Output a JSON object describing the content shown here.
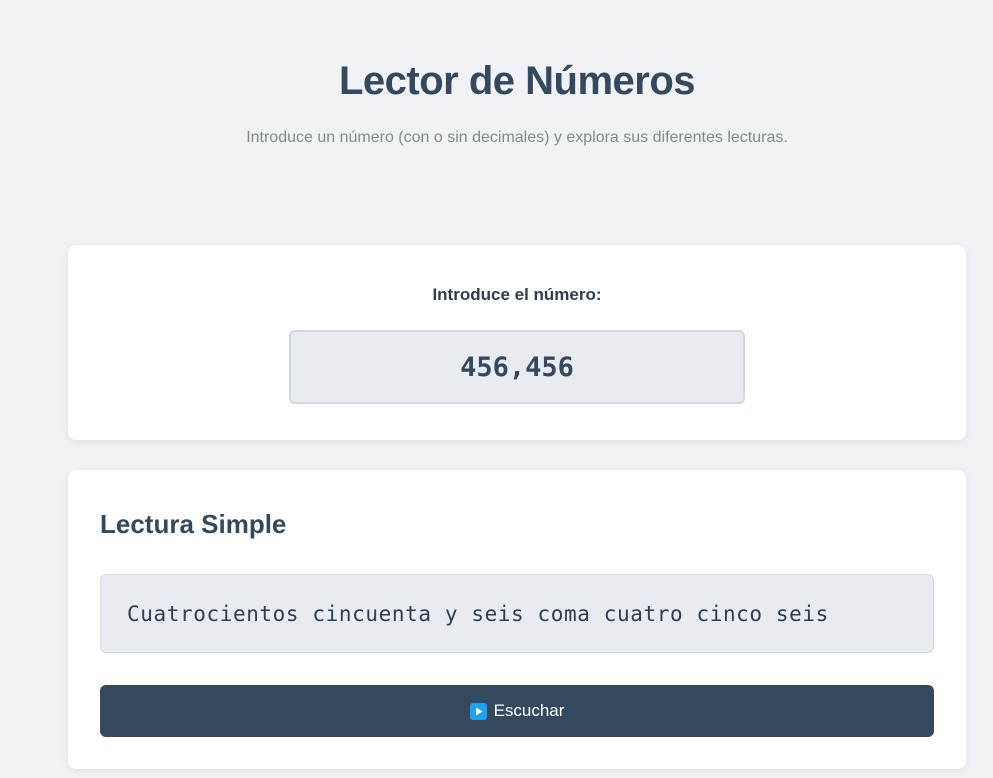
{
  "header": {
    "title": "Lector de Números",
    "subtitle": "Introduce un número (con o sin decimales) y explora sus diferentes lecturas."
  },
  "input_section": {
    "label": "Introduce el número:",
    "value": "456,456"
  },
  "reading_section": {
    "title": "Lectura Simple",
    "text": "Cuatrocientos cincuenta y seis coma cuatro cinco seis",
    "button_label": "Escuchar",
    "button_icon": "play-icon"
  },
  "colors": {
    "background": "#f0f2f5",
    "primary": "#34495e",
    "accent": "#1da1f2"
  }
}
